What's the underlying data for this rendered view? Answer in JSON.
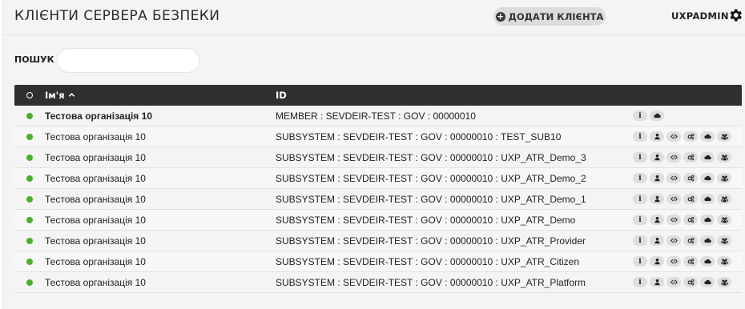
{
  "header": {
    "title": "КЛІЄНТИ СЕРВЕРА БЕЗПЕКИ",
    "add_client_label": "ДОДАТИ КЛІЄНТА",
    "username": "UXPADMIN"
  },
  "search": {
    "label": "ПОШУК",
    "value": "",
    "placeholder": ""
  },
  "table": {
    "columns": [
      "Ім'я",
      "ID"
    ],
    "sort": {
      "column": "Ім'я",
      "direction": "ascending"
    },
    "rows": [
      {
        "name": "Тестова організація 10",
        "id": "MEMBER : SEVDEIR-TEST : GOV : 00000010",
        "status": "green",
        "member": true
      },
      {
        "name": "Тестова організація 10",
        "id": "SUBSYSTEM : SEVDEIR-TEST : GOV : 00000010 : TEST_SUB10",
        "status": "green",
        "member": false
      },
      {
        "name": "Тестова організація 10",
        "id": "SUBSYSTEM : SEVDEIR-TEST : GOV : 00000010 : UXP_ATR_Demo_3",
        "status": "green",
        "member": false
      },
      {
        "name": "Тестова організація 10",
        "id": "SUBSYSTEM : SEVDEIR-TEST : GOV : 00000010 : UXP_ATR_Demo_2",
        "status": "green",
        "member": false
      },
      {
        "name": "Тестова організація 10",
        "id": "SUBSYSTEM : SEVDEIR-TEST : GOV : 00000010 : UXP_ATR_Demo_1",
        "status": "green",
        "member": false
      },
      {
        "name": "Тестова організація 10",
        "id": "SUBSYSTEM : SEVDEIR-TEST : GOV : 00000010 : UXP_ATR_Demo",
        "status": "green",
        "member": false
      },
      {
        "name": "Тестова організація 10",
        "id": "SUBSYSTEM : SEVDEIR-TEST : GOV : 00000010 : UXP_ATR_Provider",
        "status": "green",
        "member": false
      },
      {
        "name": "Тестова організація 10",
        "id": "SUBSYSTEM : SEVDEIR-TEST : GOV : 00000010 : UXP_ATR_Citizen",
        "status": "green",
        "member": false
      },
      {
        "name": "Тестова організація 10",
        "id": "SUBSYSTEM : SEVDEIR-TEST : GOV : 00000010 : UXP_ATR_Platform",
        "status": "green",
        "member": false
      }
    ],
    "member_actions": [
      "info-icon",
      "cloud-icon"
    ],
    "subsystem_actions": [
      "info-icon",
      "user-icon",
      "code-icon",
      "gears-icon",
      "cloud-icon",
      "users-icon"
    ]
  },
  "colors": {
    "status_green": "#4caf2a",
    "table_header": "#2f2f2f",
    "background": "#f4f4f4"
  }
}
